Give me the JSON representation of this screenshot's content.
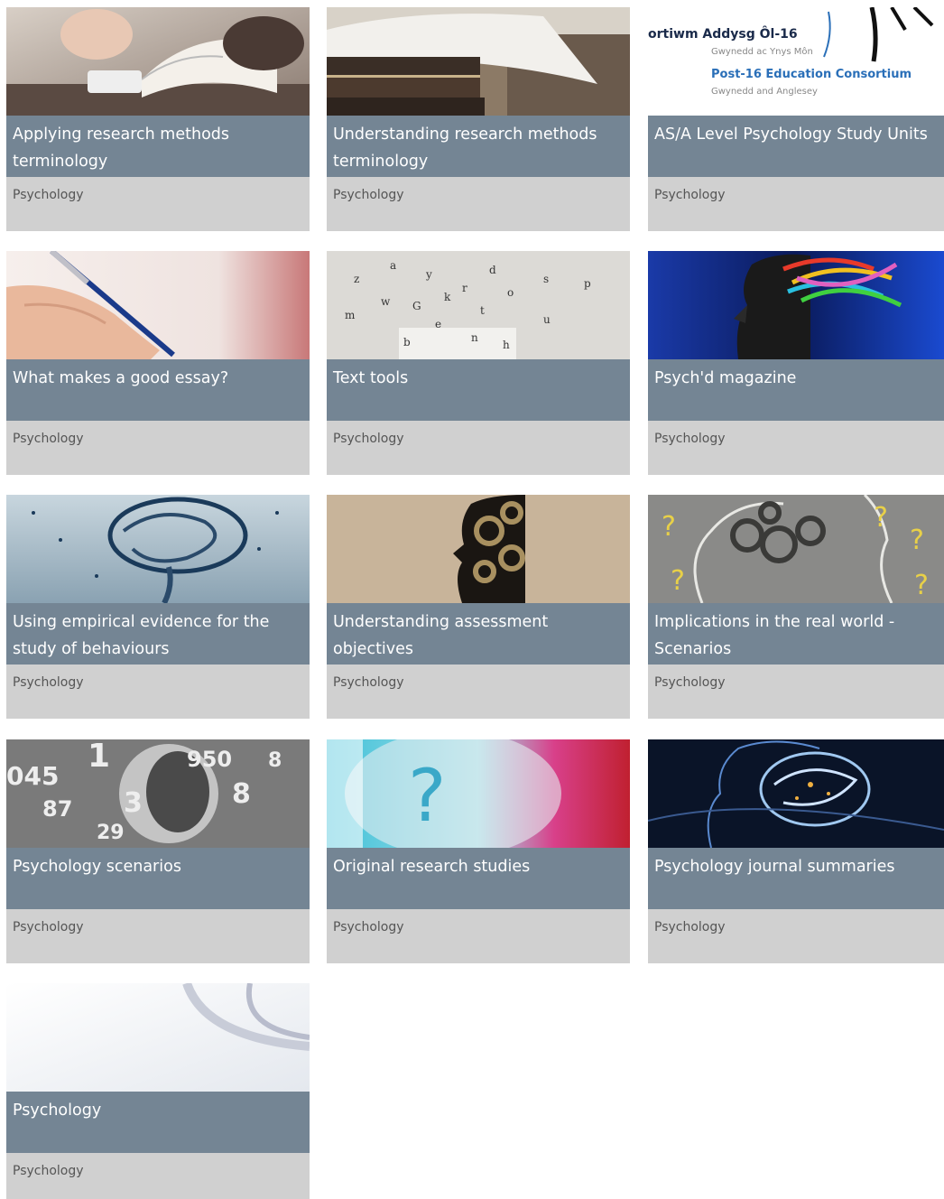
{
  "cards": [
    {
      "title": "Applying research methods terminology",
      "subject": "Psychology",
      "image": "hands-reading-book-image"
    },
    {
      "title": "Understanding research methods terminology",
      "subject": "Psychology",
      "image": "stack-of-books-image"
    },
    {
      "title": "AS/A Level Psychology Study Units",
      "subject": "Psychology",
      "image": "consortium-logo-image",
      "logo": {
        "line1": "ortiwm Addysg Ôl-16",
        "line2": "Gwynedd ac Ynys Môn",
        "line3": "Post-16 Education Consortium",
        "line4": "Gwynedd and Anglesey"
      }
    },
    {
      "title": "What makes a good essay?",
      "subject": "Psychology",
      "image": "hand-writing-pen-image"
    },
    {
      "title": "Text tools",
      "subject": "Psychology",
      "image": "scattered-letters-image"
    },
    {
      "title": "Psych'd magazine",
      "subject": "Psychology",
      "image": "head-colorful-brain-image"
    },
    {
      "title": "Using empirical evidence for the study of behaviours",
      "subject": "Psychology",
      "image": "ink-brain-image"
    },
    {
      "title": "Understanding assessment objectives",
      "subject": "Psychology",
      "image": "head-gears-image"
    },
    {
      "title": "Implications in the real world - Scenarios",
      "subject": "Psychology",
      "image": "chalk-gears-question-image"
    },
    {
      "title": "Psychology scenarios",
      "subject": "Psychology",
      "image": "numbers-collage-image"
    },
    {
      "title": "Original research studies",
      "subject": "Psychology",
      "image": "abstract-head-question-image"
    },
    {
      "title": "Psychology journal summaries",
      "subject": "Psychology",
      "image": "neural-head-image"
    },
    {
      "title": "Psychology",
      "subject": "Psychology",
      "image": "abstract-white-curve-image"
    }
  ],
  "colors": {
    "title_band": "#748594",
    "subject_band": "#d0d0d0",
    "logo_blue": "#2a6fb8"
  }
}
